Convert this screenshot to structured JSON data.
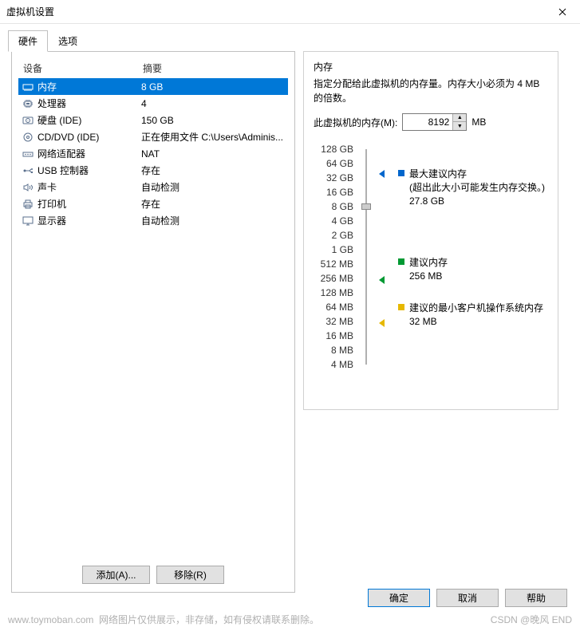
{
  "window": {
    "title": "虚拟机设置"
  },
  "tabs": [
    {
      "label": "硬件",
      "active": true
    },
    {
      "label": "选项",
      "active": false
    }
  ],
  "device_table": {
    "headers": {
      "device": "设备",
      "summary": "摘要"
    },
    "rows": [
      {
        "icon": "memory",
        "name": "内存",
        "summary": "8 GB",
        "selected": true
      },
      {
        "icon": "cpu",
        "name": "处理器",
        "summary": "4"
      },
      {
        "icon": "hdd",
        "name": "硬盘 (IDE)",
        "summary": "150 GB"
      },
      {
        "icon": "disc",
        "name": "CD/DVD (IDE)",
        "summary": "正在使用文件 C:\\Users\\Adminis..."
      },
      {
        "icon": "network",
        "name": "网络适配器",
        "summary": "NAT"
      },
      {
        "icon": "usb",
        "name": "USB 控制器",
        "summary": "存在"
      },
      {
        "icon": "sound",
        "name": "声卡",
        "summary": "自动检测"
      },
      {
        "icon": "printer",
        "name": "打印机",
        "summary": "存在"
      },
      {
        "icon": "display",
        "name": "显示器",
        "summary": "自动检测"
      }
    ]
  },
  "buttons": {
    "add": "添加(A)...",
    "remove": "移除(R)",
    "ok": "确定",
    "cancel": "取消",
    "help": "帮助"
  },
  "memory_panel": {
    "title": "内存",
    "desc": "指定分配给此虚拟机的内存量。内存大小必须为 4 MB 的倍数。",
    "input_label": "此虚拟机的内存(M):",
    "value": "8192",
    "unit": "MB",
    "slider_labels": [
      "128 GB",
      "64 GB",
      "32 GB",
      "16 GB",
      "8 GB",
      "4 GB",
      "2 GB",
      "1 GB",
      "512 MB",
      "256 MB",
      "128 MB",
      "64 MB",
      "32 MB",
      "16 MB",
      "8 MB",
      "4 MB"
    ],
    "markers": {
      "max": {
        "label": "最大建议内存",
        "note": "(超出此大小可能发生内存交换。)",
        "value": "27.8 GB",
        "color": "#0066cc"
      },
      "recommended": {
        "label": "建议内存",
        "value": "256 MB",
        "color": "#009933"
      },
      "min": {
        "label": "建议的最小客户机操作系统内存",
        "value": "32 MB",
        "color": "#e6b800"
      }
    }
  },
  "footer": {
    "site": "www.toymoban.com",
    "note": "网络图片仅供展示，非存储，如有侵权请联系删除。",
    "credit": "CSDN @晚风 END"
  }
}
